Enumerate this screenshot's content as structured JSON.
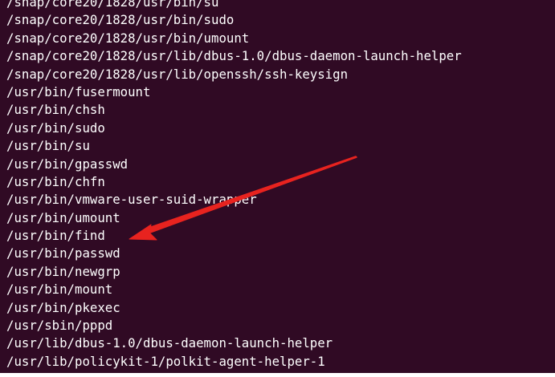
{
  "terminal": {
    "background": "#300a24",
    "text_color": "#ffffff",
    "lines": [
      "/snap/core20/1828/usr/bin/su",
      "/snap/core20/1828/usr/bin/sudo",
      "/snap/core20/1828/usr/bin/umount",
      "/snap/core20/1828/usr/lib/dbus-1.0/dbus-daemon-launch-helper",
      "/snap/core20/1828/usr/lib/openssh/ssh-keysign",
      "/usr/bin/fusermount",
      "/usr/bin/chsh",
      "/usr/bin/sudo",
      "/usr/bin/su",
      "/usr/bin/gpasswd",
      "/usr/bin/chfn",
      "/usr/bin/vmware-user-suid-wrapper",
      "/usr/bin/umount",
      "/usr/bin/find",
      "/usr/bin/passwd",
      "/usr/bin/newgrp",
      "/usr/bin/mount",
      "/usr/bin/pkexec",
      "/usr/sbin/pppd",
      "/usr/lib/dbus-1.0/dbus-daemon-launch-helper",
      "/usr/lib/policykit-1/polkit-agent-helper-1"
    ]
  },
  "annotation": {
    "shape": "arrow",
    "color": "#e8231f",
    "points_to_line": "/usr/bin/find"
  }
}
